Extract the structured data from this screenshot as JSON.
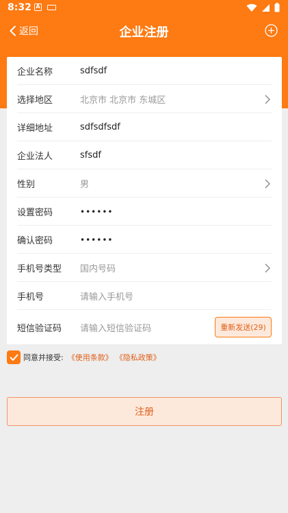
{
  "status_bar": {
    "time": "8:32"
  },
  "header": {
    "back_label": "返回",
    "title": "企业注册"
  },
  "form": {
    "rows": [
      {
        "label": "企业名称",
        "value": "sdfsdf"
      },
      {
        "label": "选择地区",
        "value": "北京市 北京市 东城区"
      },
      {
        "label": "详细地址",
        "value": "sdfsdfsdf"
      },
      {
        "label": "企业法人",
        "value": "sfsdf"
      },
      {
        "label": "性别",
        "value": "男"
      },
      {
        "label": "设置密码",
        "value": "••••••"
      },
      {
        "label": "确认密码",
        "value": "••••••"
      },
      {
        "label": "手机号类型",
        "value": "国内号码"
      },
      {
        "label": "手机号",
        "placeholder": "请输入手机号"
      },
      {
        "label": "短信验证码",
        "placeholder": "请输入短信验证码"
      }
    ],
    "resend_label": "重新发送(29)"
  },
  "agreement": {
    "checked": true,
    "text": "同意并接受:",
    "terms_link": "《使用条款》",
    "privacy_link": "《隐私政策》"
  },
  "register_label": "注册",
  "colors": {
    "accent": "#fe7a12",
    "button_bg": "#fde9dc",
    "button_text": "#e0601a"
  }
}
